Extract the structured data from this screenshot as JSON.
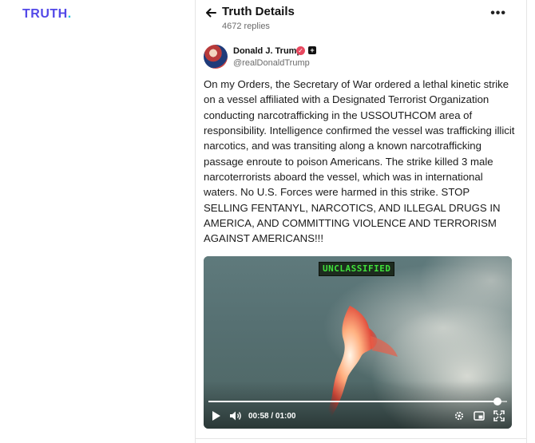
{
  "brand": {
    "logo_text": "TRUTH",
    "logo_dot": ".",
    "logo_color": "#5248e8",
    "dot_color": "#27c4d8"
  },
  "header": {
    "title": "Truth Details",
    "replies": "4672 replies"
  },
  "author": {
    "name": "Donald J. Trump",
    "handle": "@realDonaldTrump",
    "verified_icon": "verified-badge-icon",
    "extra_icon": "plus-badge-icon"
  },
  "post": {
    "text": "On my Orders, the Secretary of War ordered a lethal kinetic strike on a vessel affiliated with a Designated Terrorist Organization conducting narcotrafficking in the USSOUTHCOM area of responsibility. Intelligence confirmed the vessel was trafficking illicit narcotics, and was transiting along a known narcotrafficking passage enroute to poison Americans. The strike killed 3 male narcoterrorists aboard the vessel, which was in international waters. No U.S. Forces were harmed in this strike. STOP SELLING FENTANYL, NARCOTICS, AND ILLEGAL DRUGS IN AMERICA, AND COMMITTING VIOLENCE AND TERRORISM AGAINST AMERICANS!!!"
  },
  "video": {
    "overlay_label": "UNCLASSIFIED",
    "time_display": "00:58 / 01:00",
    "progress": 0.967,
    "overlay_color": "#3fe03b"
  }
}
